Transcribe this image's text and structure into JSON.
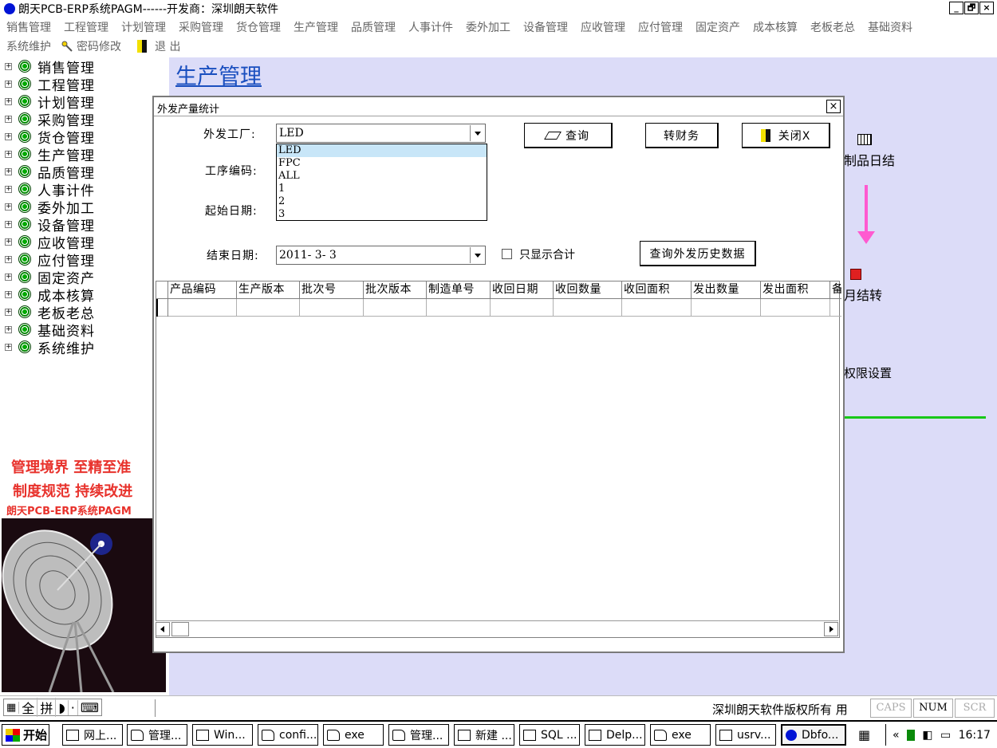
{
  "window": {
    "title": "朗天PCB-ERP系统PAGM------开发商：深圳朗天软件",
    "controls": [
      "_",
      "🗗",
      "×"
    ]
  },
  "menubar": {
    "items": [
      "销售管理",
      "工程管理",
      "计划管理",
      "采购管理",
      "货仓管理",
      "生产管理",
      "品质管理",
      "人事计件",
      "委外加工",
      "设备管理",
      "应收管理",
      "应付管理",
      "固定资产",
      "成本核算",
      "老板老总",
      "基础资料"
    ]
  },
  "toolbar2": {
    "system_maint": "系统维护",
    "password": "密码修改",
    "exit": "退 出"
  },
  "tree": {
    "items": [
      "销售管理",
      "工程管理",
      "计划管理",
      "采购管理",
      "货仓管理",
      "生产管理",
      "品质管理",
      "人事计件",
      "委外加工",
      "设备管理",
      "应收管理",
      "应付管理",
      "固定资产",
      "成本核算",
      "老板老总",
      "基础资料",
      "系统维护"
    ]
  },
  "slogan": {
    "line1": "管理境界 至精至准",
    "line2": "制度规范 持续改进",
    "line3": "朗天PCB-ERP系统PAGM"
  },
  "background": {
    "title": "生产管理",
    "daily": "制品日结",
    "monthly": "月结转",
    "permissions": "权限设置",
    "arrow_color": "#ff5ad0",
    "line_color": "#18c818"
  },
  "dialog": {
    "title": "外发产量统计",
    "close": "×",
    "factory_label": "外发工厂:",
    "factory_value": "LED",
    "process_label": "工序编码:",
    "start_label": "起始日期:",
    "end_label": "结束日期:",
    "end_value": "2011- 3- 3",
    "dropdown_options": [
      "LED",
      "FPC",
      "ALL",
      "1",
      "2",
      "3"
    ],
    "query_btn": "查询",
    "finance_btn": "转财务",
    "close_btn": "关闭X",
    "only_total": "只显示合计",
    "history_btn": "查询外发历史数据",
    "columns": [
      "产品编码",
      "生产版本",
      "批次号",
      "批次版本",
      "制造单号",
      "收回日期",
      "收回数量",
      "收回面积",
      "发出数量",
      "发出面积",
      "备"
    ]
  },
  "statusbar": {
    "ime": [
      "全",
      "拼"
    ],
    "copyright": "深圳朗天软件版权所有",
    "extra": "用",
    "caps": "CAPS",
    "num": "NUM",
    "scr": "SCR"
  },
  "taskbar": {
    "start": "开始",
    "tasks": [
      "网上...",
      "管理...",
      "Win...",
      "confi...",
      "exe",
      "管理...",
      "新建 ...",
      "SQL ...",
      "Delp...",
      "exe",
      "usrv...",
      "Dbfo..."
    ],
    "clock": "16:17"
  }
}
